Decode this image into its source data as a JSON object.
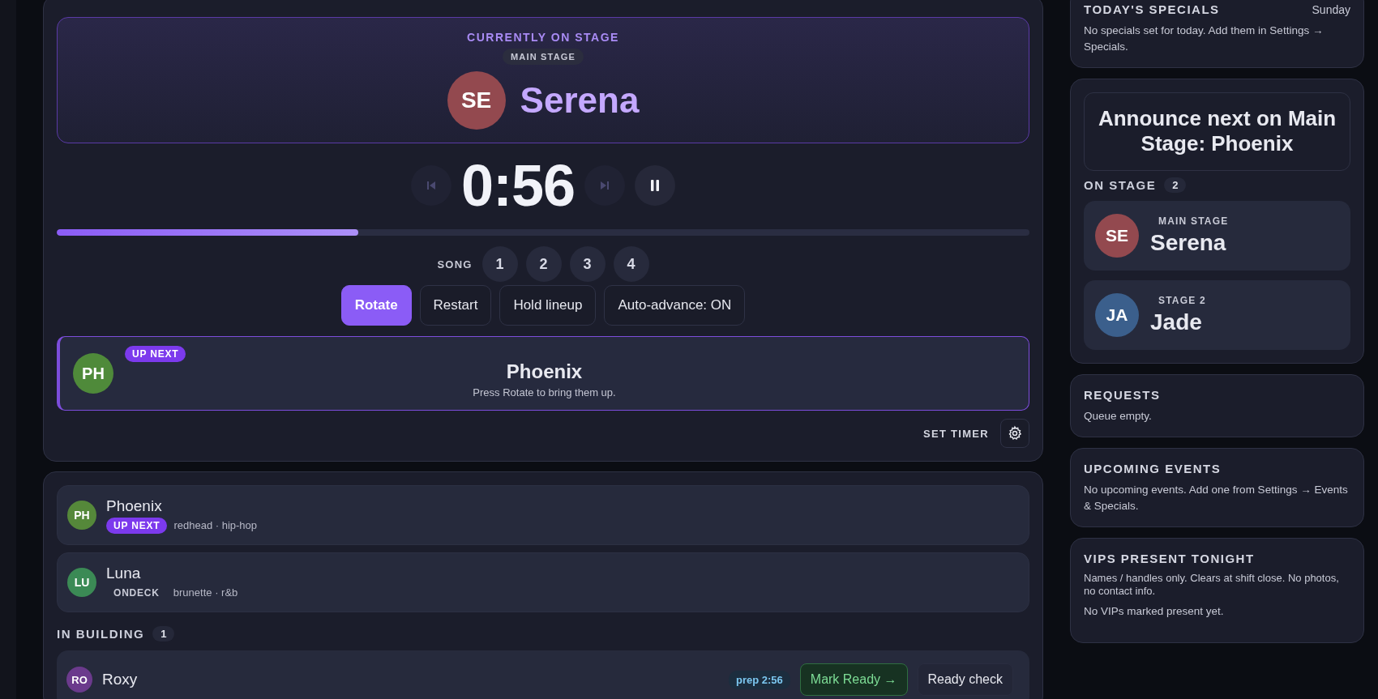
{
  "hero": {
    "label": "CURRENTLY ON STAGE",
    "stage": "MAIN STAGE",
    "initials": "SE",
    "name": "Serena",
    "color": "#93494f"
  },
  "timer": {
    "display": "0:56",
    "level": 0.31
  },
  "transport": [
    {
      "kind": "prev",
      "disabled": true
    },
    {
      "kind": "next",
      "disabled": true
    },
    {
      "kind": "pause",
      "disabled": false
    }
  ],
  "songs": {
    "label": "SONG",
    "items": [
      "1",
      "2",
      "3",
      "4"
    ]
  },
  "actions": [
    {
      "label": "Rotate",
      "kind": "primary"
    },
    {
      "label": "Restart",
      "kind": "secondary"
    },
    {
      "label": "Hold lineup",
      "kind": "secondary"
    },
    {
      "label": "Auto-advance: ON",
      "kind": "secondary"
    }
  ],
  "up_next": {
    "badge": "UP NEXT",
    "initials": "PH",
    "color": "#4f8a3a",
    "name": "Phoenix",
    "hint": "Press Rotate to bring them up."
  },
  "set_timer": {
    "label": "SET TIMER"
  },
  "lineup": [
    {
      "initials": "PH",
      "color": "#55883a",
      "name": "Phoenix",
      "badge": "UP NEXT",
      "kind": "up_next",
      "tags": "redhead · hip-hop"
    },
    {
      "initials": "LU",
      "color": "#3b8a55",
      "name": "Luna",
      "badge": "ONDECK",
      "kind": "on_deck",
      "tags": "brunette · r&b"
    }
  ],
  "in_building": {
    "label": "IN BUILDING",
    "count": "1",
    "rows": [
      {
        "initials": "RO",
        "color": "#6b3a8c",
        "name": "Roxy",
        "prep": "prep 2:56",
        "actions": [
          {
            "label": "Mark Ready →",
            "kind": "ready"
          },
          {
            "label": "Ready check",
            "kind": "plain"
          }
        ]
      }
    ]
  },
  "specials": {
    "title": "TODAY'S SPECIALS",
    "day": "Sunday",
    "text": "No specials set for today. Add them in Settings → Specials."
  },
  "announce": {
    "text": "Announce next on Main Stage: Phoenix"
  },
  "on_stage": {
    "label": "ON STAGE",
    "count": "2",
    "items": [
      {
        "initials": "SE",
        "color": "#93494f",
        "stage": "MAIN STAGE",
        "name": "Serena"
      },
      {
        "initials": "JA",
        "color": "#3b5f8c",
        "stage": "STAGE 2",
        "name": "Jade"
      }
    ]
  },
  "requests": {
    "title": "REQUESTS",
    "text": "Queue empty."
  },
  "events": {
    "title": "UPCOMING EVENTS",
    "text": "No upcoming events. Add one from Settings → Events & Specials."
  },
  "vips": {
    "title": "VIPS PRESENT TONIGHT",
    "note": "Names / handles only. Clears at shift close. No photos, no contact info.",
    "text": "No VIPs marked present yet."
  }
}
